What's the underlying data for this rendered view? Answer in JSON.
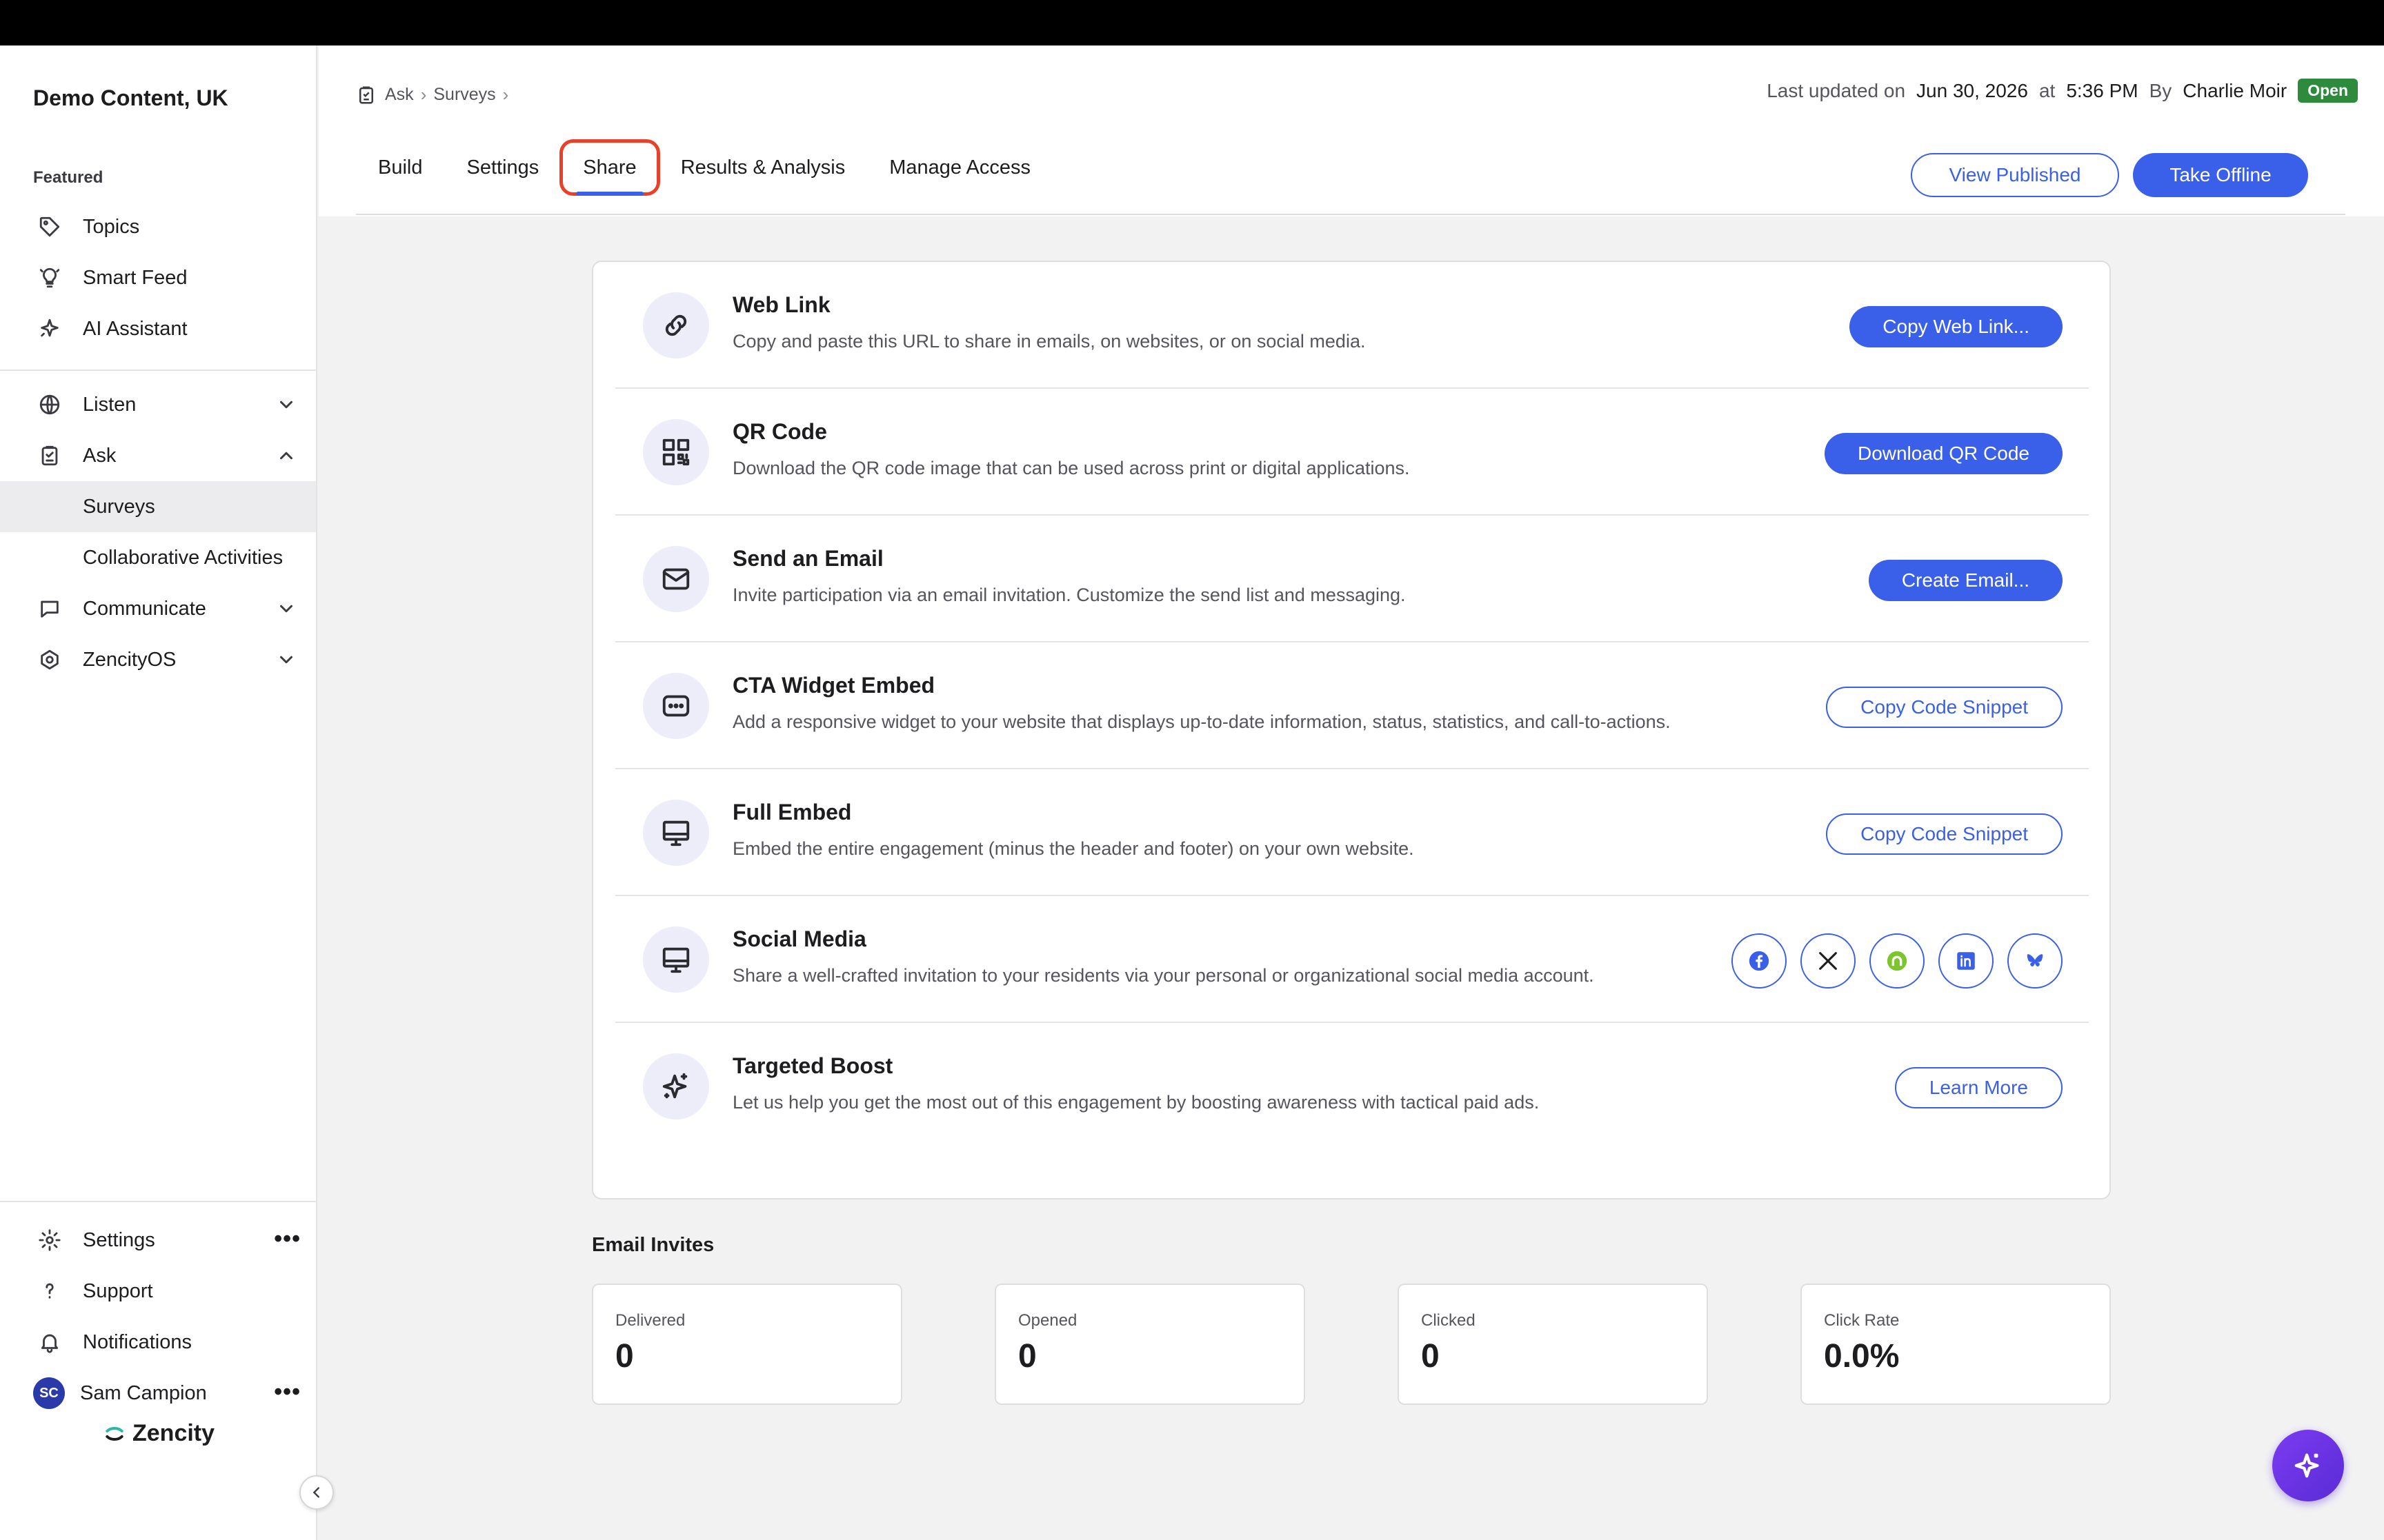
{
  "org_name": "Demo Content, UK",
  "sidebar": {
    "section_label": "Featured",
    "featured": [
      {
        "label": "Topics",
        "icon": "tag-icon"
      },
      {
        "label": "Smart Feed",
        "icon": "lightbulb-icon"
      },
      {
        "label": "AI Assistant",
        "icon": "sparkle-icon"
      }
    ],
    "groups": [
      {
        "label": "Listen",
        "icon": "globe-icon",
        "expanded": false
      },
      {
        "label": "Ask",
        "icon": "clipboard-icon",
        "expanded": true
      },
      {
        "label": "Communicate",
        "icon": "chat-icon",
        "expanded": false
      },
      {
        "label": "ZencityOS",
        "icon": "zencity-os-icon",
        "expanded": false
      }
    ],
    "ask_children": [
      {
        "label": "Surveys",
        "active": true
      },
      {
        "label": "Collaborative Activities",
        "active": false
      }
    ],
    "bottom": [
      {
        "label": "Settings",
        "icon": "gear-icon"
      },
      {
        "label": "Support",
        "icon": "question-icon"
      },
      {
        "label": "Notifications",
        "icon": "bell-icon"
      }
    ],
    "user": {
      "initials": "SC",
      "name": "Sam Campion"
    },
    "brand": "Zencity"
  },
  "breadcrumb": [
    "Ask",
    "Surveys"
  ],
  "meta": {
    "prefix": "Last updated on",
    "date": "Jun 30, 2026",
    "at": "at",
    "time": "5:36 PM",
    "by": "By",
    "author": "Charlie Moir",
    "status": "Open"
  },
  "tabs": [
    {
      "label": "Build",
      "active": false
    },
    {
      "label": "Settings",
      "active": false
    },
    {
      "label": "Share",
      "active": true
    },
    {
      "label": "Results & Analysis",
      "active": false
    },
    {
      "label": "Manage Access",
      "active": false
    }
  ],
  "header_actions": {
    "view_published": "View Published",
    "take_offline": "Take Offline"
  },
  "share_rows": [
    {
      "title": "Web Link",
      "desc": "Copy and paste this URL to share in emails, on websites, or on social media.",
      "button": "Copy Web Link...",
      "style": "solid",
      "icon": "link-icon"
    },
    {
      "title": "QR Code",
      "desc": "Download the QR code image that can be used across print or digital applications.",
      "button": "Download QR Code",
      "style": "solid",
      "icon": "qr-code-icon"
    },
    {
      "title": "Send an Email",
      "desc": "Invite participation via an email invitation. Customize the send list and messaging.",
      "button": "Create Email...",
      "style": "solid",
      "icon": "mail-icon"
    },
    {
      "title": "CTA Widget Embed",
      "desc": "Add a responsive widget to your website that displays up-to-date information, status, statistics, and call-to-actions.",
      "button": "Copy Code Snippet",
      "style": "outline",
      "icon": "widget-icon"
    },
    {
      "title": "Full Embed",
      "desc": "Embed the entire engagement (minus the header and footer) on your own website.",
      "button": "Copy Code Snippet",
      "style": "outline",
      "icon": "monitor-icon"
    },
    {
      "title": "Social Media",
      "desc": "Share a well-crafted invitation to your residents via your personal or organizational social media account.",
      "button": "",
      "style": "social",
      "icon": "monitor-icon"
    },
    {
      "title": "Targeted Boost",
      "desc": "Let us help you get the most out of this engagement by boosting awareness with tactical paid ads.",
      "button": "Learn More",
      "style": "outline",
      "icon": "sparkle-icon"
    }
  ],
  "socials": [
    "facebook-icon",
    "x-icon",
    "nextdoor-icon",
    "linkedin-icon",
    "bluesky-icon"
  ],
  "invites": {
    "title": "Email Invites",
    "stats": [
      {
        "label": "Delivered",
        "value": "0"
      },
      {
        "label": "Opened",
        "value": "0"
      },
      {
        "label": "Clicked",
        "value": "0"
      },
      {
        "label": "Click Rate",
        "value": "0.0%"
      }
    ]
  },
  "colors": {
    "accent": "#3a5fe8",
    "status_open": "#2e8b3e",
    "highlight": "#e8402a"
  }
}
